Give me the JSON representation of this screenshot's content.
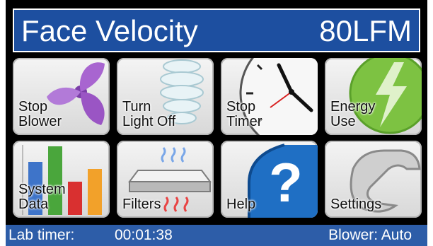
{
  "header": {
    "title": "Face Velocity",
    "value": "80LFM"
  },
  "tiles": [
    {
      "line1": "Stop",
      "line2": "Blower",
      "icon": "fan-icon"
    },
    {
      "line1": "Turn",
      "line2": "Light Off",
      "icon": "light-bulb-icon"
    },
    {
      "line1": "Stop",
      "line2": "Timer",
      "icon": "clock-icon"
    },
    {
      "line1": "Energy",
      "line2": "Use",
      "icon": "lightning-icon"
    },
    {
      "line1": "System",
      "line2": "Data",
      "icon": "bar-chart-icon"
    },
    {
      "line1": "Filters",
      "line2": "",
      "icon": "filter-icon"
    },
    {
      "line1": "Help",
      "line2": "",
      "icon": "question-mark-icon"
    },
    {
      "line1": "Settings",
      "line2": "",
      "icon": "wrench-icon"
    }
  ],
  "status": {
    "timer_label": "Lab timer:",
    "timer_value": "00:01:38",
    "blower": "Blower: Auto"
  },
  "colors": {
    "header_bg": "#1d4fa0",
    "status_bg": "#2d5da8",
    "fan": "#9a55c4",
    "energy": "#7dc242",
    "help": "#1f6fc4"
  }
}
